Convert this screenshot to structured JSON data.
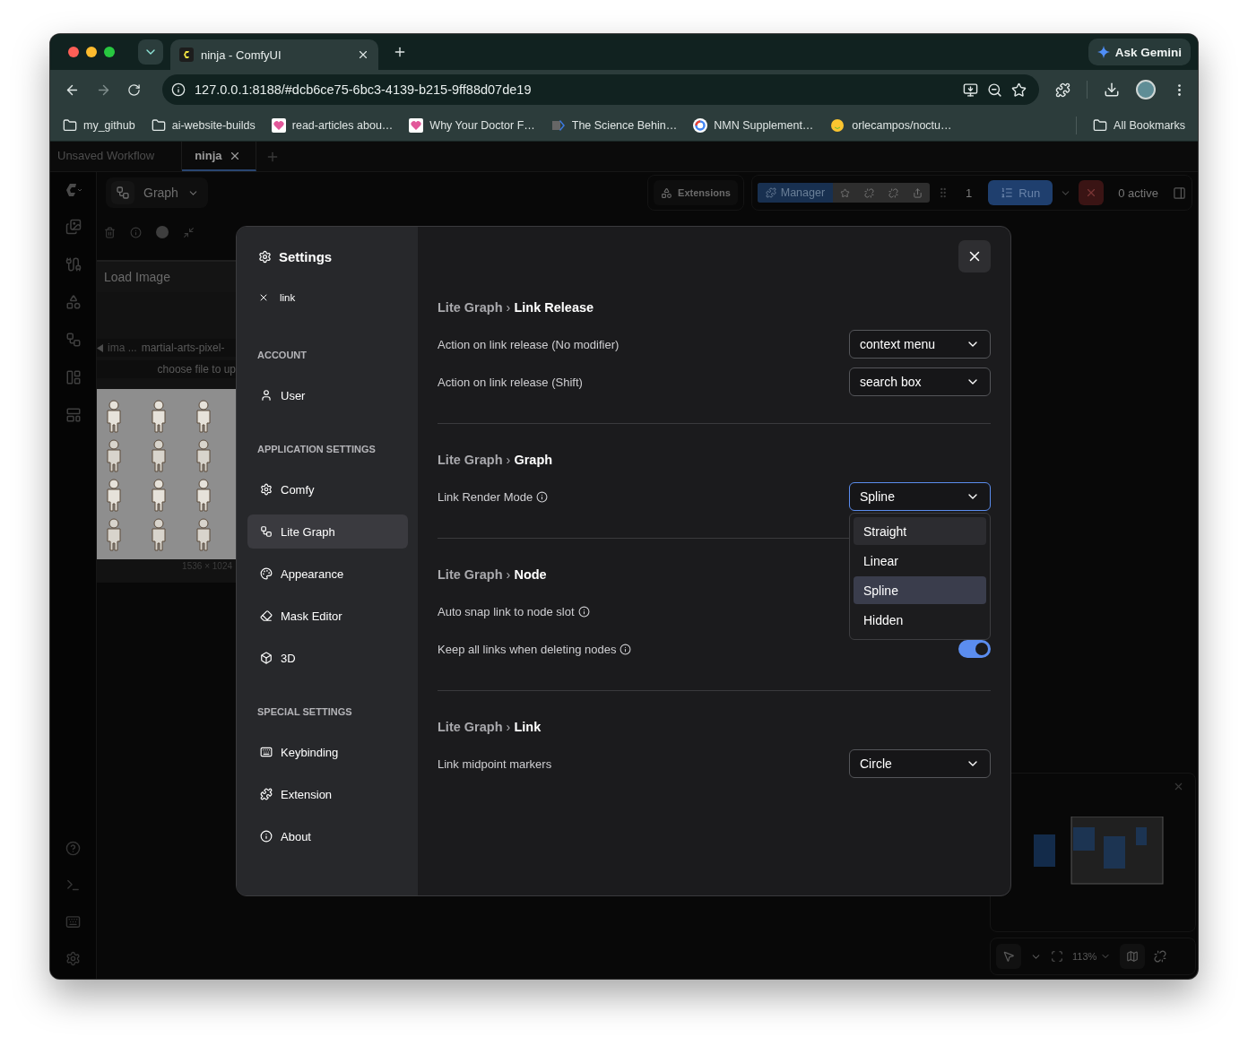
{
  "browser": {
    "tabs": [
      {
        "title": "ninja - ComfyUI",
        "selected": true
      }
    ],
    "url": "127.0.0.1:8188/#dcb6ce75-6bc3-4139-b215-9ff88d07de19",
    "gemini": "Ask Gemini",
    "bookmarks": [
      {
        "label": "my_github"
      },
      {
        "label": "ai-website-builds"
      },
      {
        "label": "read-articles abou…"
      },
      {
        "label": "Why Your Doctor F…"
      },
      {
        "label": "The Science Behin…"
      },
      {
        "label": "NMN Supplement…"
      },
      {
        "label": "orlecampos/noctu…"
      }
    ],
    "all_bookmarks": "All Bookmarks"
  },
  "workflow_tabs": [
    {
      "label": "Unsaved Workflow",
      "selected": false
    },
    {
      "label": "ninja",
      "selected": true
    }
  ],
  "topbar": {
    "graph": "Graph",
    "extensions": "Extensions",
    "manager": "Manager",
    "queue_count": "1",
    "run": "Run",
    "active": "0 active"
  },
  "node": {
    "title": "Load Image",
    "image_prefix": "ima",
    "ellipsis": "...",
    "filename": "martial-arts-pixel-",
    "upload": "choose file to up",
    "size": "1536 × 1024"
  },
  "zoom": "113%",
  "settings": {
    "title": "Settings",
    "search": "link",
    "separator": "›",
    "nav": [
      {
        "heading": "ACCOUNT",
        "items": [
          {
            "label": "User",
            "selected": false
          }
        ]
      },
      {
        "heading": "APPLICATION SETTINGS",
        "items": [
          {
            "label": "Comfy",
            "selected": false
          },
          {
            "label": "Lite Graph",
            "selected": true
          },
          {
            "label": "Appearance",
            "selected": false
          },
          {
            "label": "Mask Editor",
            "selected": false
          },
          {
            "label": "3D",
            "selected": false
          }
        ]
      },
      {
        "heading": "SPECIAL SETTINGS",
        "items": [
          {
            "label": "Keybinding",
            "selected": false
          },
          {
            "label": "Extension",
            "selected": false
          },
          {
            "label": "About",
            "selected": false
          }
        ]
      }
    ],
    "groups": [
      {
        "category": "Lite Graph",
        "name": "Link Release",
        "rows": [
          {
            "label": "Action on link release (No modifier)",
            "info": false,
            "kind": "select",
            "value": "context menu",
            "open": false
          },
          {
            "label": "Action on link release (Shift)",
            "info": false,
            "kind": "select",
            "value": "search box",
            "open": false
          }
        ]
      },
      {
        "category": "Lite Graph",
        "name": "Graph",
        "rows": [
          {
            "label": "Link Render Mode",
            "info": true,
            "kind": "select",
            "value": "Spline",
            "open": true,
            "options": [
              {
                "label": "Straight",
                "selected": false,
                "hovered": true
              },
              {
                "label": "Linear",
                "selected": false,
                "hovered": false
              },
              {
                "label": "Spline",
                "selected": true,
                "hovered": false
              },
              {
                "label": "Hidden",
                "selected": false,
                "hovered": false
              }
            ]
          }
        ]
      },
      {
        "category": "Lite Graph",
        "name": "Node",
        "rows": [
          {
            "label": "Auto snap link to node slot",
            "info": true,
            "kind": "covered"
          },
          {
            "label": "Keep all links when deleting nodes",
            "info": true,
            "kind": "toggle",
            "on": true
          }
        ]
      },
      {
        "category": "Lite Graph",
        "name": "Link",
        "rows": [
          {
            "label": "Link midpoint markers",
            "info": false,
            "kind": "select",
            "value": "Circle",
            "open": false
          }
        ]
      }
    ]
  }
}
